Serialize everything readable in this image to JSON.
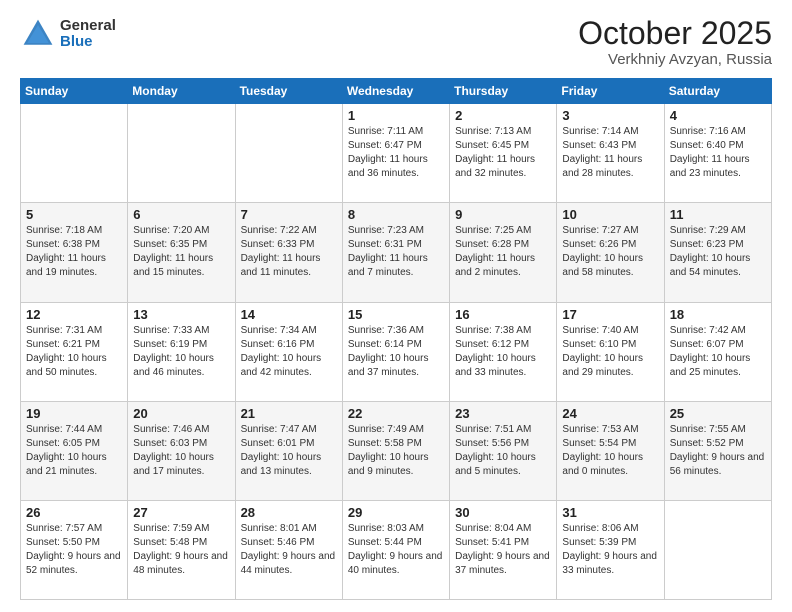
{
  "logo": {
    "general": "General",
    "blue": "Blue"
  },
  "header": {
    "month": "October 2025",
    "location": "Verkhniy Avzyan, Russia"
  },
  "weekdays": [
    "Sunday",
    "Monday",
    "Tuesday",
    "Wednesday",
    "Thursday",
    "Friday",
    "Saturday"
  ],
  "weeks": [
    [
      null,
      null,
      null,
      {
        "day": 1,
        "sunrise": "7:11 AM",
        "sunset": "6:47 PM",
        "daylight": "11 hours and 36 minutes."
      },
      {
        "day": 2,
        "sunrise": "7:13 AM",
        "sunset": "6:45 PM",
        "daylight": "11 hours and 32 minutes."
      },
      {
        "day": 3,
        "sunrise": "7:14 AM",
        "sunset": "6:43 PM",
        "daylight": "11 hours and 28 minutes."
      },
      {
        "day": 4,
        "sunrise": "7:16 AM",
        "sunset": "6:40 PM",
        "daylight": "11 hours and 23 minutes."
      }
    ],
    [
      {
        "day": 5,
        "sunrise": "7:18 AM",
        "sunset": "6:38 PM",
        "daylight": "11 hours and 19 minutes."
      },
      {
        "day": 6,
        "sunrise": "7:20 AM",
        "sunset": "6:35 PM",
        "daylight": "11 hours and 15 minutes."
      },
      {
        "day": 7,
        "sunrise": "7:22 AM",
        "sunset": "6:33 PM",
        "daylight": "11 hours and 11 minutes."
      },
      {
        "day": 8,
        "sunrise": "7:23 AM",
        "sunset": "6:31 PM",
        "daylight": "11 hours and 7 minutes."
      },
      {
        "day": 9,
        "sunrise": "7:25 AM",
        "sunset": "6:28 PM",
        "daylight": "11 hours and 2 minutes."
      },
      {
        "day": 10,
        "sunrise": "7:27 AM",
        "sunset": "6:26 PM",
        "daylight": "10 hours and 58 minutes."
      },
      {
        "day": 11,
        "sunrise": "7:29 AM",
        "sunset": "6:23 PM",
        "daylight": "10 hours and 54 minutes."
      }
    ],
    [
      {
        "day": 12,
        "sunrise": "7:31 AM",
        "sunset": "6:21 PM",
        "daylight": "10 hours and 50 minutes."
      },
      {
        "day": 13,
        "sunrise": "7:33 AM",
        "sunset": "6:19 PM",
        "daylight": "10 hours and 46 minutes."
      },
      {
        "day": 14,
        "sunrise": "7:34 AM",
        "sunset": "6:16 PM",
        "daylight": "10 hours and 42 minutes."
      },
      {
        "day": 15,
        "sunrise": "7:36 AM",
        "sunset": "6:14 PM",
        "daylight": "10 hours and 37 minutes."
      },
      {
        "day": 16,
        "sunrise": "7:38 AM",
        "sunset": "6:12 PM",
        "daylight": "10 hours and 33 minutes."
      },
      {
        "day": 17,
        "sunrise": "7:40 AM",
        "sunset": "6:10 PM",
        "daylight": "10 hours and 29 minutes."
      },
      {
        "day": 18,
        "sunrise": "7:42 AM",
        "sunset": "6:07 PM",
        "daylight": "10 hours and 25 minutes."
      }
    ],
    [
      {
        "day": 19,
        "sunrise": "7:44 AM",
        "sunset": "6:05 PM",
        "daylight": "10 hours and 21 minutes."
      },
      {
        "day": 20,
        "sunrise": "7:46 AM",
        "sunset": "6:03 PM",
        "daylight": "10 hours and 17 minutes."
      },
      {
        "day": 21,
        "sunrise": "7:47 AM",
        "sunset": "6:01 PM",
        "daylight": "10 hours and 13 minutes."
      },
      {
        "day": 22,
        "sunrise": "7:49 AM",
        "sunset": "5:58 PM",
        "daylight": "10 hours and 9 minutes."
      },
      {
        "day": 23,
        "sunrise": "7:51 AM",
        "sunset": "5:56 PM",
        "daylight": "10 hours and 5 minutes."
      },
      {
        "day": 24,
        "sunrise": "7:53 AM",
        "sunset": "5:54 PM",
        "daylight": "10 hours and 0 minutes."
      },
      {
        "day": 25,
        "sunrise": "7:55 AM",
        "sunset": "5:52 PM",
        "daylight": "9 hours and 56 minutes."
      }
    ],
    [
      {
        "day": 26,
        "sunrise": "7:57 AM",
        "sunset": "5:50 PM",
        "daylight": "9 hours and 52 minutes."
      },
      {
        "day": 27,
        "sunrise": "7:59 AM",
        "sunset": "5:48 PM",
        "daylight": "9 hours and 48 minutes."
      },
      {
        "day": 28,
        "sunrise": "8:01 AM",
        "sunset": "5:46 PM",
        "daylight": "9 hours and 44 minutes."
      },
      {
        "day": 29,
        "sunrise": "8:03 AM",
        "sunset": "5:44 PM",
        "daylight": "9 hours and 40 minutes."
      },
      {
        "day": 30,
        "sunrise": "8:04 AM",
        "sunset": "5:41 PM",
        "daylight": "9 hours and 37 minutes."
      },
      {
        "day": 31,
        "sunrise": "8:06 AM",
        "sunset": "5:39 PM",
        "daylight": "9 hours and 33 minutes."
      },
      null
    ]
  ]
}
